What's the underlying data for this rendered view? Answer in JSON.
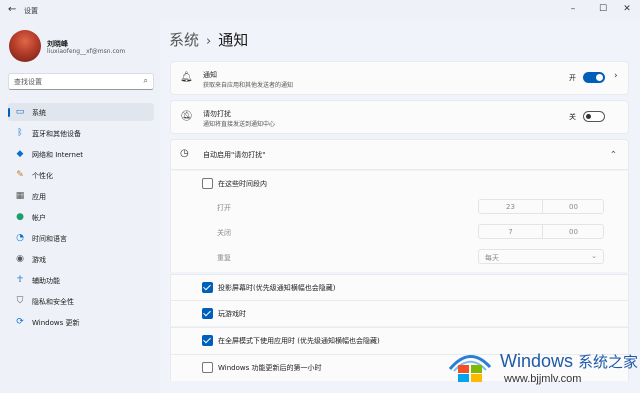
{
  "window": {
    "title": "设置",
    "back_icon": "back-arrow-icon",
    "controls": [
      "minimize-icon",
      "maximize-icon",
      "close-icon"
    ]
  },
  "user": {
    "name": "刘晓峰",
    "email": "liuxiaofeng__xf@msn.com"
  },
  "search": {
    "placeholder": "查找设置"
  },
  "sidebar": {
    "items": [
      {
        "label": "系统",
        "icon": "monitor-icon",
        "active": true
      },
      {
        "label": "蓝牙和其他设备",
        "icon": "bluetooth-icon"
      },
      {
        "label": "网络和 Internet",
        "icon": "wifi-icon"
      },
      {
        "label": "个性化",
        "icon": "brush-icon"
      },
      {
        "label": "应用",
        "icon": "apps-icon"
      },
      {
        "label": "帐户",
        "icon": "person-icon"
      },
      {
        "label": "时间和语言",
        "icon": "globe-clock-icon"
      },
      {
        "label": "游戏",
        "icon": "gamepad-icon"
      },
      {
        "label": "辅助功能",
        "icon": "accessibility-icon"
      },
      {
        "label": "隐私和安全性",
        "icon": "shield-icon"
      },
      {
        "label": "Windows 更新",
        "icon": "update-icon"
      }
    ]
  },
  "breadcrumb": {
    "parent": "系统",
    "separator": "›",
    "current": "通知"
  },
  "notifications": {
    "title": "通知",
    "subtitle": "获取来自应用和其他发送者的通知",
    "toggle_label": "开",
    "on": true
  },
  "dnd": {
    "title": "请勿打扰",
    "subtitle": "通知将直接发送到通知中心",
    "toggle_label": "关",
    "on": false
  },
  "auto_dnd": {
    "title": "自动启用\"请勿打扰\"",
    "during_times": {
      "label": "在这些时间段内",
      "checked": false
    },
    "start": {
      "label": "打开",
      "hour": "23",
      "minute": "00"
    },
    "end": {
      "label": "关闭",
      "hour": "7",
      "minute": "00"
    },
    "repeat": {
      "label": "重复",
      "value": "每天"
    },
    "options": [
      {
        "label": "投影屏幕时(优先级通知横幅也会隐藏)",
        "checked": true
      },
      {
        "label": "玩游戏时",
        "checked": true
      },
      {
        "label": "在全屏模式下使用应用时 (优先级通知横幅也会隐藏)",
        "checked": true
      },
      {
        "label": "Windows 功能更新后的第一小时",
        "checked": false
      }
    ]
  },
  "watermark": {
    "brand": "Windows",
    "cn": "系统之家",
    "url": "www.bjjmlv.com"
  },
  "colors": {
    "accent": "#005fb8",
    "sidebar_bg": "#eef1f8",
    "card_bg": "#fbfbfc"
  }
}
